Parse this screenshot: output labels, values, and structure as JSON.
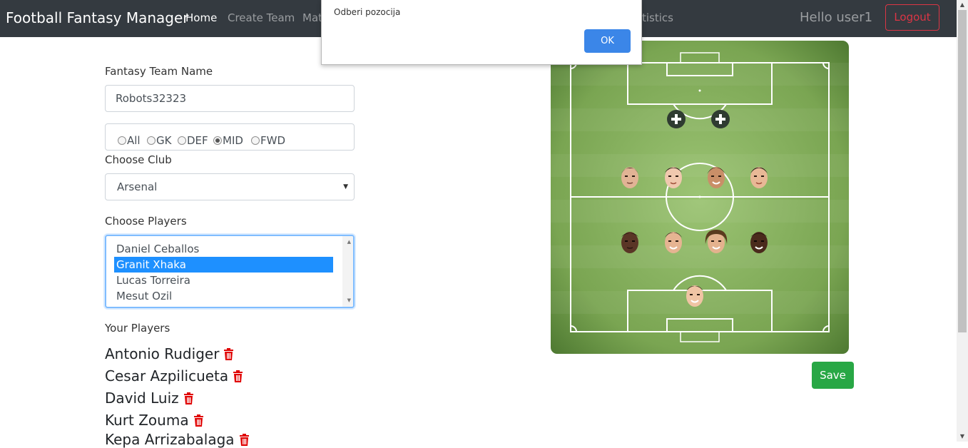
{
  "navbar": {
    "brand": "Football Fantasy Manager",
    "links": [
      {
        "label": "Home"
      },
      {
        "label": "Create Team"
      },
      {
        "label": "Mat"
      },
      {
        "label": "tistics"
      }
    ],
    "greeting": "Hello user1",
    "logout_label": "Logout"
  },
  "dialog": {
    "message": "Odberi pozocija",
    "ok_label": "OK"
  },
  "form": {
    "team_name_label": "Fantasy Team Name",
    "team_name_value": "Robots32323",
    "positions": [
      {
        "label": "All",
        "checked": false
      },
      {
        "label": "GK",
        "checked": false
      },
      {
        "label": "DEF",
        "checked": false
      },
      {
        "label": "MID",
        "checked": true
      },
      {
        "label": "FWD",
        "checked": false
      }
    ],
    "club_label": "Choose Club",
    "club_value": "Arsenal",
    "players_label": "Choose Players",
    "players": [
      {
        "name": "Daniel Ceballos",
        "selected": false
      },
      {
        "name": "Granit Xhaka",
        "selected": true
      },
      {
        "name": "Lucas Torreira",
        "selected": false
      },
      {
        "name": "Mesut Ozil",
        "selected": false
      }
    ],
    "your_players_label": "Your Players",
    "your_players": [
      "Antonio Rudiger",
      "Cesar Azpilicueta",
      "David Luiz",
      "Kurt Zouma",
      "Kepa Arrizabalaga"
    ]
  },
  "save_label": "Save",
  "colors": {
    "navbar": "#343a40",
    "pitch": "#7faa5a",
    "save": "#28a745",
    "logout": "#dc3545",
    "selected_option": "#1e90ff",
    "trash": "#e00000"
  }
}
